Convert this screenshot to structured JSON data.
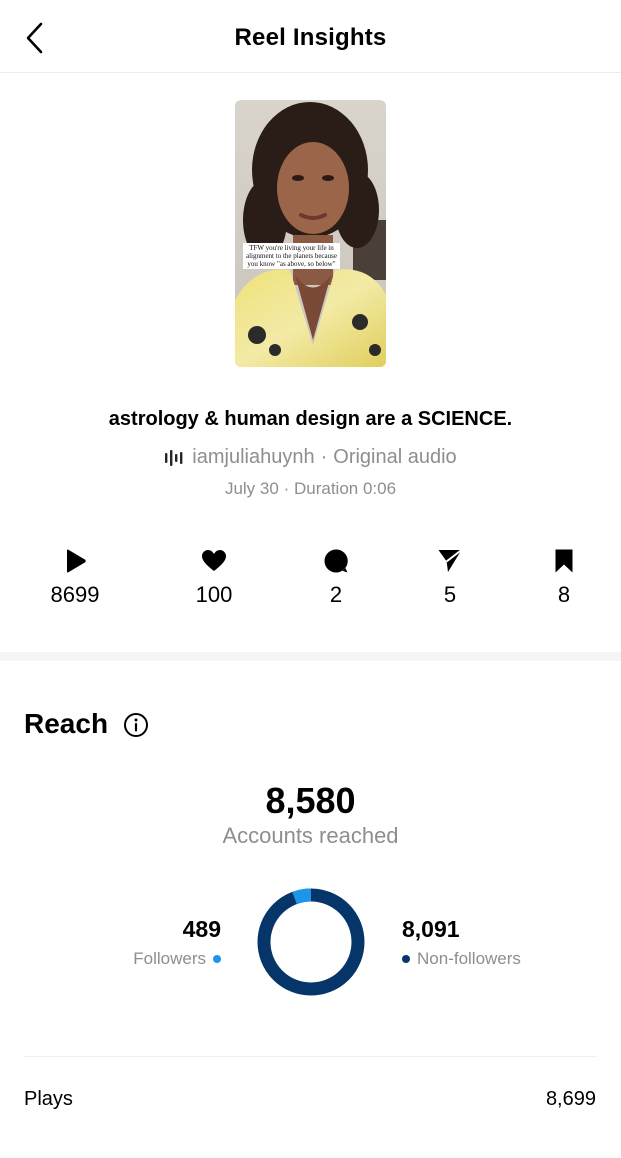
{
  "header": {
    "title": "Reel Insights",
    "back_icon": "chevron-left-icon"
  },
  "reel": {
    "thumbnail_caption": "TFW you're living your life in alignment to the planets because you know \"as above, so below\"",
    "title": "astrology & human design are a SCIENCE.",
    "audio_username": "iamjuliahuynh",
    "audio_separator": "·",
    "audio_name": "Original audio",
    "date": "July 30",
    "meta_separator": "·",
    "duration": "Duration 0:06"
  },
  "stats": [
    {
      "icon": "play-icon",
      "value": "8699"
    },
    {
      "icon": "heart-icon",
      "value": "100"
    },
    {
      "icon": "comment-icon",
      "value": "2"
    },
    {
      "icon": "share-icon",
      "value": "5"
    },
    {
      "icon": "bookmark-icon",
      "value": "8"
    }
  ],
  "reach": {
    "title": "Reach",
    "info_icon": "info-icon",
    "accounts_reached": "8,580",
    "accounts_reached_label": "Accounts reached",
    "followers": {
      "value": "489",
      "label": "Followers",
      "color": "#1c96e8"
    },
    "non_followers": {
      "value": "8,091",
      "label": "Non-followers",
      "color": "#06356a"
    }
  },
  "chart_data": {
    "type": "pie",
    "categories": [
      "Followers",
      "Non-followers"
    ],
    "values": [
      489,
      8091
    ],
    "colors": [
      "#1c96e8",
      "#06356a"
    ]
  },
  "plays": {
    "label": "Plays",
    "value": "8,699"
  }
}
